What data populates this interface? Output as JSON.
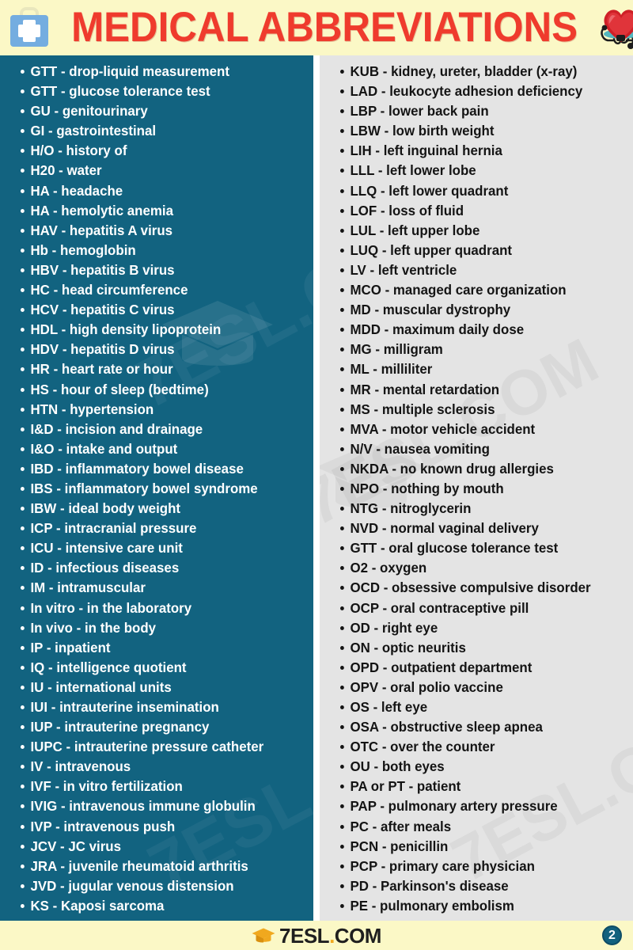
{
  "header": {
    "title": "MEDICAL ABBREVIATIONS",
    "left_icon": "medical-bag-icon",
    "right_icon": "heart-stethoscope-icon",
    "background_color": "#fbf8c6",
    "title_color": "#ef3b2d"
  },
  "columns": {
    "left": {
      "background_color": "#126380",
      "text_color": "#ffffff",
      "items": [
        "GTT - drop-liquid measurement",
        "GTT - glucose tolerance test",
        "GU - genitourinary",
        "GI - gastrointestinal",
        "H/O - history of",
        "H20 - water",
        "HA - headache",
        "HA - hemolytic anemia",
        "HAV - hepatitis A virus",
        "Hb - hemoglobin",
        "HBV - hepatitis B virus",
        "HC - head circumference",
        "HCV - hepatitis C virus",
        "HDL - high density lipoprotein",
        "HDV - hepatitis D virus",
        "HR - heart rate or hour",
        "HS - hour of sleep (bedtime)",
        "HTN - hypertension",
        "I&D - incision and drainage",
        "I&O - intake and output",
        "IBD - inflammatory bowel disease",
        "IBS - inflammatory bowel syndrome",
        "IBW - ideal body weight",
        "ICP - intracranial pressure",
        "ICU - intensive care unit",
        "ID - infectious diseases",
        "IM - intramuscular",
        "In vitro - in the laboratory",
        "In vivo - in the body",
        "IP - inpatient",
        "IQ - intelligence quotient",
        "IU - international units",
        "IUI - intrauterine insemination",
        "IUP - intrauterine pregnancy",
        "IUPC - intrauterine pressure catheter",
        "IV - intravenous",
        "IVF - in vitro fertilization",
        "IVIG - intravenous immune globulin",
        "IVP - intravenous push",
        "JCV - JC virus",
        "JRA - juvenile rheumatoid arthritis",
        "JVD - jugular venous distension",
        "KS - Kaposi sarcoma"
      ]
    },
    "right": {
      "background_color": "#e4e4e4",
      "text_color": "#141414",
      "items": [
        "KUB - kidney, ureter, bladder (x-ray)",
        "LAD - leukocyte adhesion deficiency",
        "LBP - lower back pain",
        "LBW - low birth weight",
        "LIH - left inguinal hernia",
        "LLL - left lower lobe",
        "LLQ - left lower quadrant",
        "LOF - loss of fluid",
        "LUL - left upper lobe",
        "LUQ - left upper quadrant",
        "LV - left ventricle",
        "MCO - managed care organization",
        "MD - muscular dystrophy",
        "MDD - maximum daily dose",
        "MG - milligram",
        "ML - milliliter",
        "MR - mental retardation",
        "MS - multiple sclerosis",
        "MVA - motor vehicle accident",
        "N/V - nausea vomiting",
        "NKDA - no known drug allergies",
        "NPO - nothing by mouth",
        "NTG - nitroglycerin",
        "NVD - normal vaginal delivery",
        "GTT - oral glucose tolerance test",
        "O2 - oxygen",
        "OCD - obsessive compulsive disorder",
        "OCP - oral contraceptive pill",
        "OD - right eye",
        "ON - optic neuritis",
        "OPD - outpatient department",
        "OPV - oral polio vaccine",
        "OS - left eye",
        "OSA - obstructive sleep apnea",
        "OTC - over the counter",
        "OU - both eyes",
        "PA or PT - patient",
        "PAP - pulmonary artery pressure",
        "PC - after meals",
        "PCN - penicillin",
        "PCP - primary care physician",
        "PD - Parkinson's disease",
        "PE - pulmonary embolism"
      ]
    }
  },
  "watermark": {
    "text": "7ESL.COM"
  },
  "footer": {
    "logo_icon": "graduation-cap-icon",
    "logo_part1": "7ESL",
    "logo_dot": ".",
    "logo_part2": "COM",
    "page_number": "2",
    "background_color": "#fbf8c6",
    "badge_color": "#12617e"
  }
}
